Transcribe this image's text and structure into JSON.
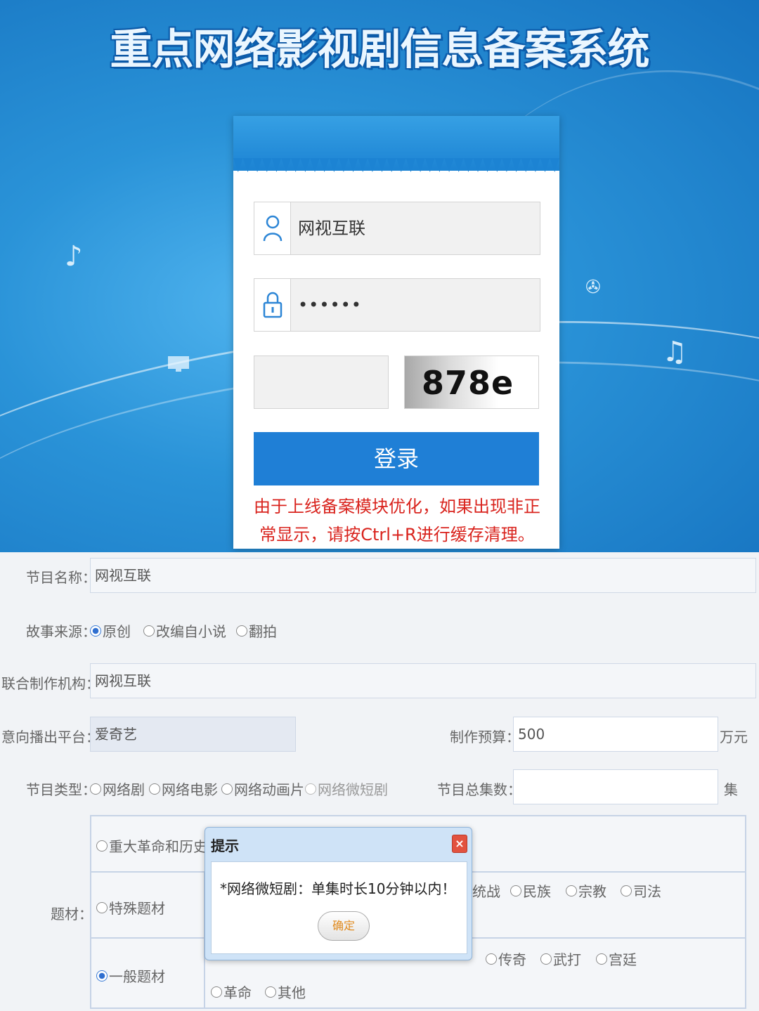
{
  "login": {
    "site_title": "重点网络影视剧信息备案系统",
    "username_value": "网视互联",
    "password_value": "••••••",
    "captcha_text": "878e",
    "login_button": "登录",
    "notice": "由于上线备案模块优化，如果出现非正常显示，请按Ctrl+R进行缓存清理。"
  },
  "form": {
    "program_name": {
      "label": "节目名称：",
      "value": "网视互联"
    },
    "story_source": {
      "label": "故事来源：",
      "options": [
        "原创",
        "改编自小说",
        "翻拍"
      ],
      "selected": "原创"
    },
    "co_producer": {
      "label": "联合制作机构：",
      "value": "网视互联"
    },
    "platform": {
      "label": "意向播出平台：",
      "value": "爱奇艺"
    },
    "budget": {
      "label": "制作预算：",
      "value": "500",
      "unit": "万元"
    },
    "program_type": {
      "label": "节目类型：",
      "options": [
        "网络剧",
        "网络电影",
        "网络动画片",
        "网络微短剧"
      ]
    },
    "episodes": {
      "label": "节目总集数：",
      "value": "",
      "unit": "集"
    },
    "topic": {
      "label": "题材：",
      "row1_option": "重大革命和历史题",
      "row2_option": "特殊题材",
      "row2_extra": [
        "统战",
        "民族",
        "宗教",
        "司法"
      ],
      "row3_option": "一般题材",
      "row3_extra": [
        "传奇",
        "武打",
        "宫廷"
      ],
      "row3_extra2": [
        "革命",
        "其他"
      ]
    }
  },
  "dialog": {
    "title": "提示",
    "close_label": "×",
    "message": "*网络微短剧：单集时长10分钟以内！",
    "ok_button": "确定"
  }
}
